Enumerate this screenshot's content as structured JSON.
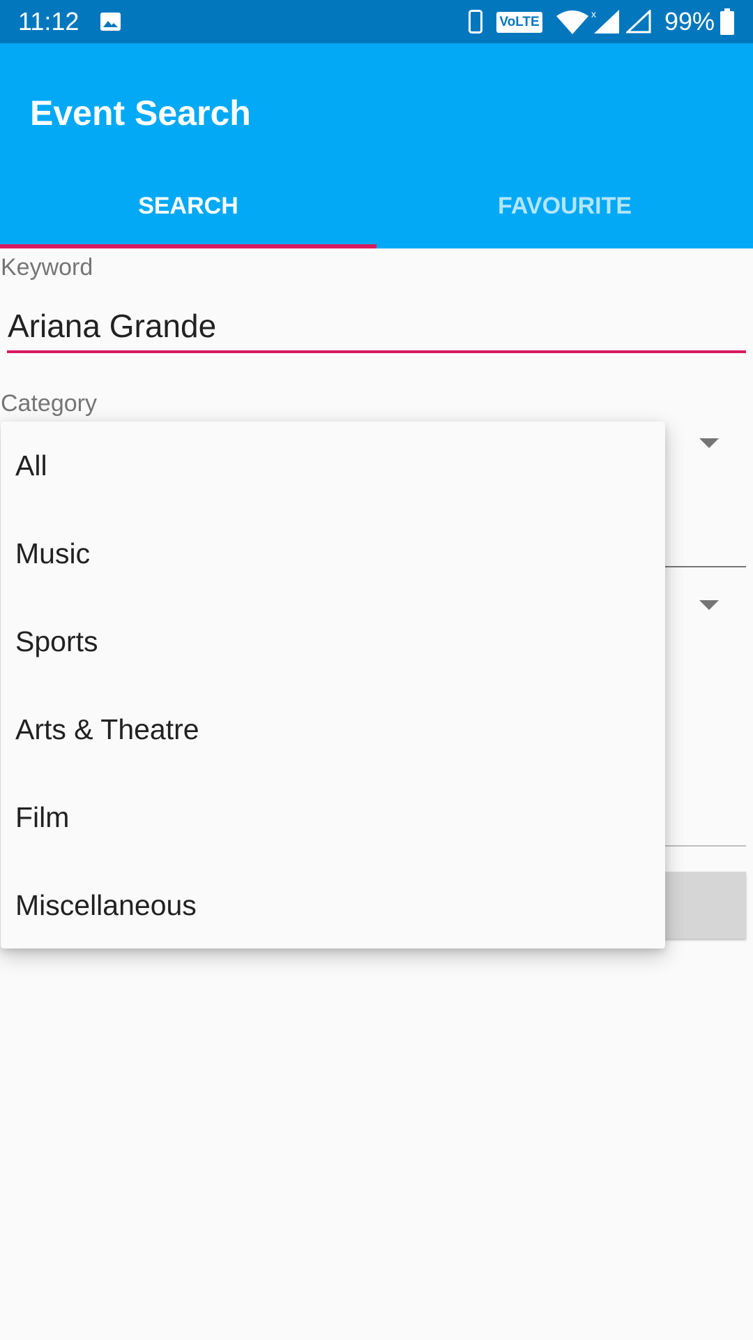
{
  "status_bar": {
    "time": "11:12",
    "battery_percent": "99%",
    "icons": [
      "gallery-icon",
      "phone-icon",
      "volte-icon",
      "wifi-icon",
      "signal-icon",
      "signal-empty-icon",
      "battery-icon"
    ],
    "volte_label": "VoLTE"
  },
  "app_bar": {
    "title": "Event Search",
    "tabs": [
      {
        "label": "SEARCH",
        "selected": true
      },
      {
        "label": "FAVOURITE",
        "selected": false
      }
    ],
    "colors": {
      "primary": "#03a9f4",
      "primary_dark": "#0277bd",
      "accent": "#d81b60"
    }
  },
  "form": {
    "keyword_label": "Keyword",
    "keyword_value": "Ariana Grande",
    "category_label": "Category"
  },
  "dropdown": {
    "items": [
      "All",
      "Music",
      "Sports",
      "Arts & Theatre",
      "Film",
      "Miscellaneous"
    ]
  }
}
